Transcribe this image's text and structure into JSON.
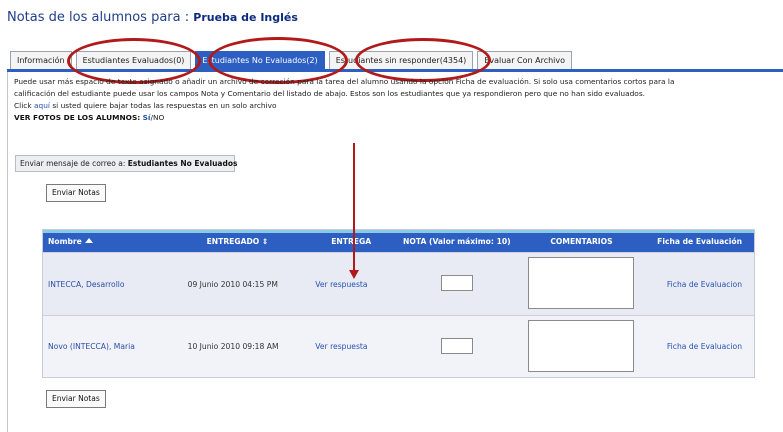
{
  "page": {
    "title_prefix": "Notas de los alumnos para :",
    "course_name": "Prueba de Inglés"
  },
  "tabs": [
    {
      "label": "Información",
      "active": false
    },
    {
      "label": "Estudiantes Evaluados(0)",
      "active": false
    },
    {
      "label": "Estudiantes No Evaluados(2)",
      "active": true
    },
    {
      "label": "Estudiantes sin responder(4354)",
      "active": false
    },
    {
      "label": "Evaluar Con Archivo",
      "active": false
    }
  ],
  "intro": {
    "line1": "Puede usar más espacio de texto asignado o añadir un archivo de correción para la tarea del alumno usando la opción Ficha de evaluación. Si solo usa comentarios cortos para la",
    "line2": "calificación del estudiante puede usar los campos Nota y Comentario del listado de abajo. Estos son los estudiantes que ya respondieron pero que no han sido evaluados.",
    "click_prefix": "Click",
    "click_link": "aquí",
    "click_suffix": "si usted quiere bajar todas las respuestas en un solo archivo",
    "photos_label": "VER FOTOS DE LOS ALUMNOS:",
    "photos_yes": "Sí",
    "photos_sep": "/",
    "photos_no": "NO"
  },
  "mail": {
    "label": "Enviar mensaje de correo a:",
    "target": "Estudiantes No Evaluados"
  },
  "buttons": {
    "send_top": "Enviar Notas",
    "send_bottom": "Enviar Notas"
  },
  "table": {
    "headers": {
      "name": "Nombre",
      "delivered": "ENTREGADO",
      "delivered_sort_icon": "⇕",
      "delivery": "ENTREGA",
      "grade": "NOTA (Valor máximo: 10)",
      "comments": "COMENTARIOS",
      "sheet": "Ficha de Evaluación"
    },
    "rows": [
      {
        "name": "INTECCA, Desarrollo",
        "date": "09 Junio 2010 04:15 PM",
        "answer": "Ver respuesta",
        "grade": "",
        "comment": "",
        "sheet": "Ficha de Evaluacion"
      },
      {
        "name": "Novo (INTECCA), Maria",
        "date": "10 Junio 2010 09:18 AM",
        "answer": "Ver respuesta",
        "grade": "",
        "comment": "",
        "sheet": "Ficha de Evaluacion"
      }
    ]
  },
  "colors": {
    "tab_active": "#2d5ec2",
    "annotation_red": "#b01a1a",
    "link_blue": "#2750b0"
  }
}
